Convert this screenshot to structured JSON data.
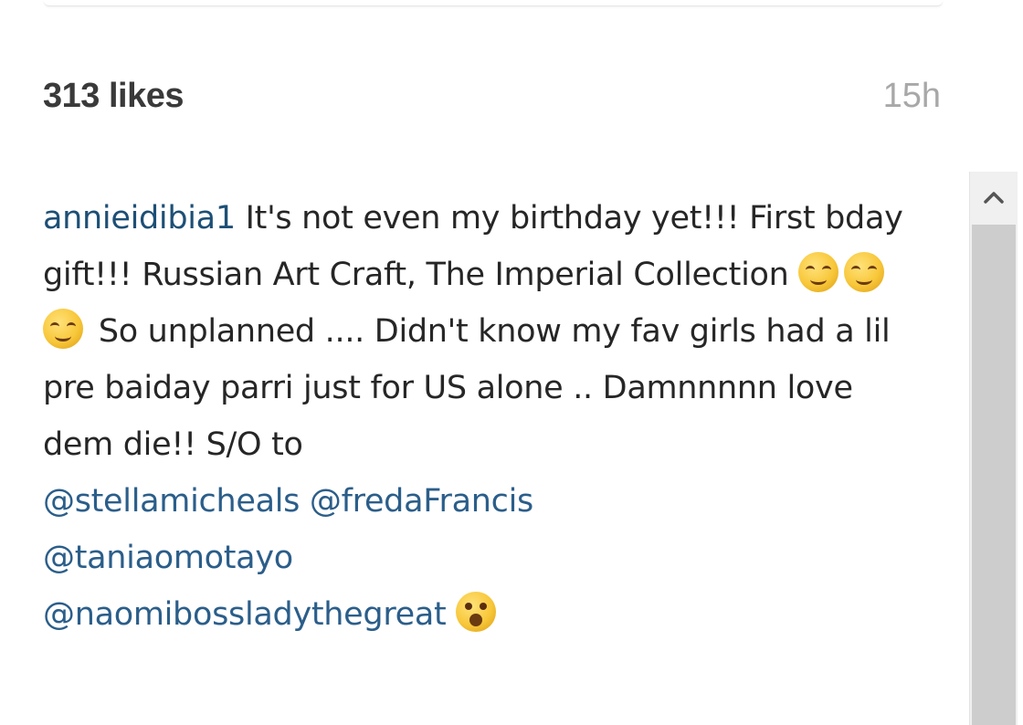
{
  "post": {
    "likes": "313 likes",
    "time": "15h"
  },
  "caption": {
    "username": "annieidibia1",
    "text_1": " It's not even my birthday yet!!! First bday gift!!! Russian Art Craft, The Imperial Collection ",
    "text_2": " So unplanned .... Didn't know my fav girls had a lil pre baiday parri just for US alone .. Damnnnnn love dem die!! S/O to ",
    "mentions": [
      "@stellamicheals",
      "@fredaFrancis",
      "@taniaomotayo",
      "@naomibossladythegreat"
    ]
  },
  "emojis": [
    "smiling-face-icon",
    "smiling-face-icon",
    "smiling-face-icon",
    "astonished-face-icon"
  ],
  "colors": {
    "username": "#1d4f76",
    "mention": "#2b5e8a",
    "time": "#a8a8a8"
  }
}
